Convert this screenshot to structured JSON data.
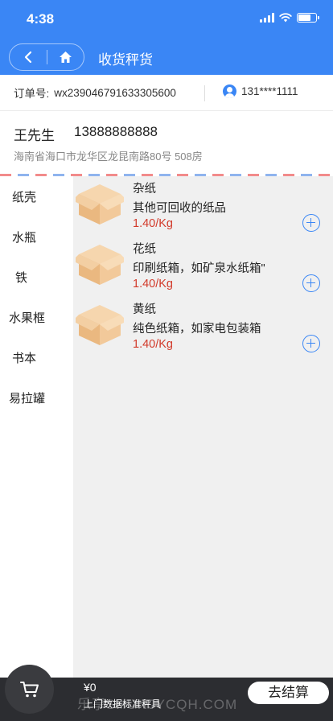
{
  "status_bar": {
    "time": "4:38"
  },
  "nav": {
    "title": "收货秤货"
  },
  "order": {
    "label": "订单号:",
    "number": "wx23904679163330560",
    "number_suffix": "0",
    "phone": "131****1111"
  },
  "address": {
    "name": "王先生",
    "phone": "13888888888",
    "line": "海南省海口市龙华区龙昆南路80号 508房"
  },
  "categories": [
    "纸壳",
    "水瓶",
    "铁",
    "水果框",
    "书本",
    "易拉罐"
  ],
  "items": [
    {
      "name": "杂纸",
      "desc": "其他可回收的纸品",
      "price": "1.40/Kg"
    },
    {
      "name": "花纸",
      "desc": "印刷纸箱，如矿泉水纸箱\"",
      "price": "1.40/Kg"
    },
    {
      "name": "黄纸",
      "desc": "纯色纸箱，如家电包装箱",
      "price": "1.40/Kg"
    }
  ],
  "bottom": {
    "total": "¥0",
    "note": "上门数据标准秤具",
    "checkout": "去结算",
    "watermark": "乐享SHUNJYCQH.COM"
  },
  "colors": {
    "primary": "#3a86f5",
    "price": "#d23a2a",
    "bottom_bar": "#2c2d31"
  },
  "icons": [
    "back-icon",
    "home-icon",
    "user-icon",
    "add-icon",
    "cart-icon",
    "box-icon"
  ]
}
